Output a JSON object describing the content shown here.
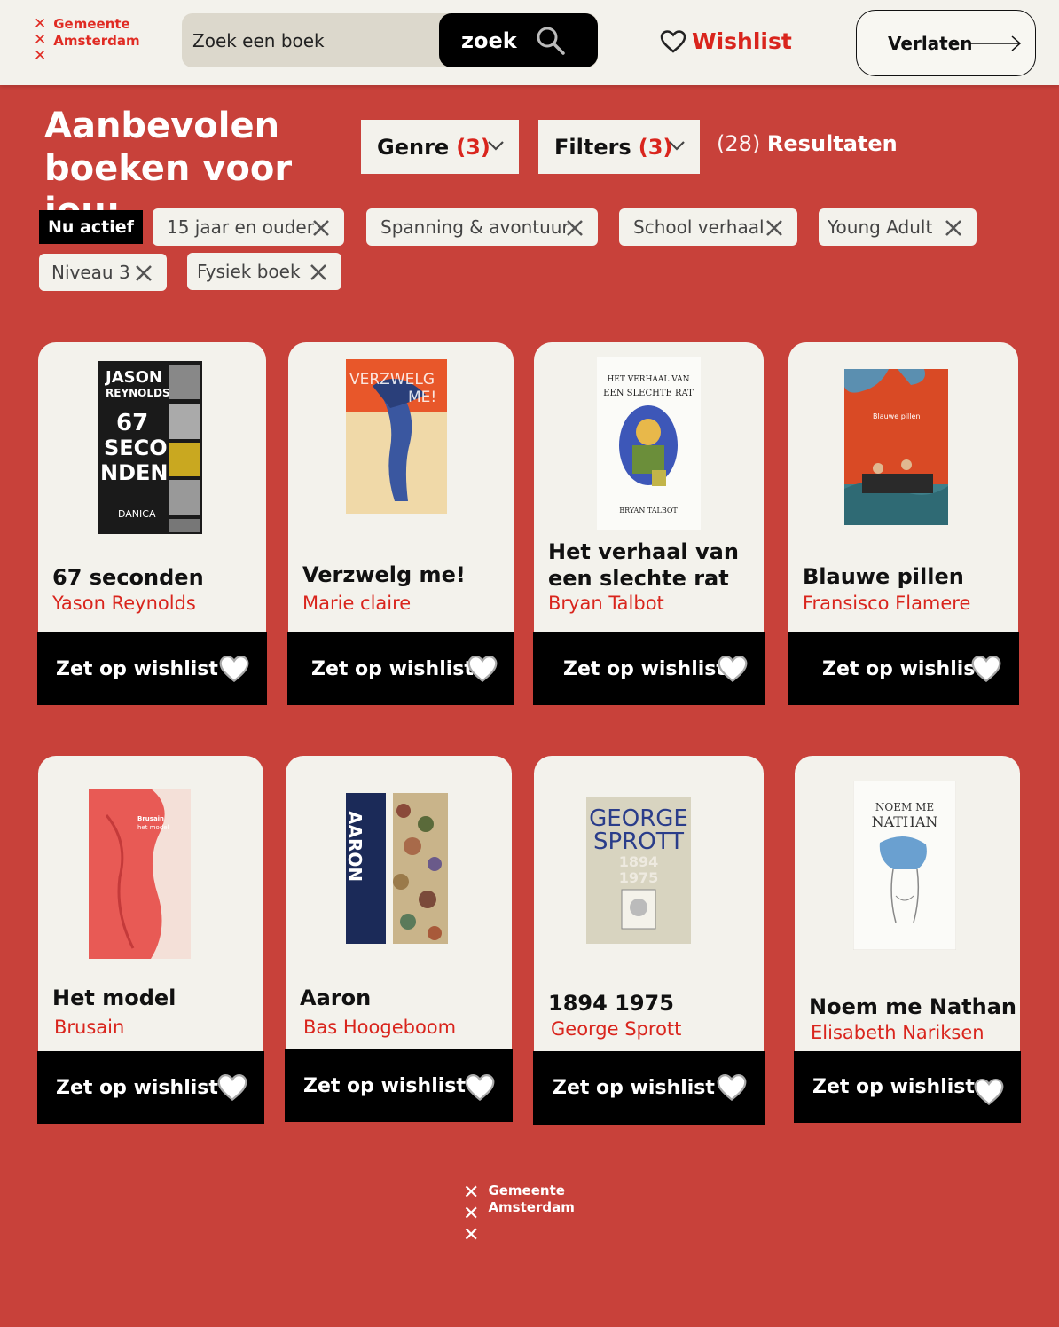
{
  "header": {
    "logo_line1": "Gemeente",
    "logo_line2": "Amsterdam",
    "search_placeholder": "Zoek een boek",
    "search_button": "zoek",
    "wishlist_label": "Wishlist",
    "leave_label": "Verlaten"
  },
  "filters": {
    "title_line1": "Aanbevolen",
    "title_line2": "boeken voor jou:",
    "genre_label": "Genre",
    "genre_count": "(3)",
    "filters_label": "Filters",
    "filters_count": "(3)",
    "results_count": "(28)",
    "results_label": "Resultaten",
    "active_label": "Nu actief",
    "chips": [
      "15 jaar en ouder",
      "Spanning & avontuur",
      "School verhaal",
      "Young Adult",
      "Niveau 3",
      "Fysiek boek"
    ]
  },
  "books": [
    {
      "title": "67 seconden",
      "author": "Yason Reynolds",
      "button": "Zet op wishlist"
    },
    {
      "title": "Verzwelg me!",
      "author": "Marie claire",
      "button": "Zet op wishlist"
    },
    {
      "title_line1": "Het verhaal van",
      "title_line2": "een slechte rat",
      "author": "Bryan Talbot",
      "button": "Zet op wishlist"
    },
    {
      "title": "Blauwe pillen",
      "author": "Fransisco Flamere",
      "button": "Zet op wishlist"
    },
    {
      "title": "Het model",
      "author": "Brusain",
      "button": "Zet op wishlist"
    },
    {
      "title": "Aaron",
      "author": "Bas Hoogeboom",
      "button": "Zet op wishlist"
    },
    {
      "title": "1894 1975",
      "author": "George Sprott",
      "button": "Zet op wishlist"
    },
    {
      "title": "Noem me Nathan",
      "author": "Elisabeth Nariksen",
      "button": "Zet op wishlist"
    }
  ],
  "covers": {
    "c1_a": "JASON",
    "c1_b": "REYNOLDS",
    "c1_c": "67",
    "c1_d": "SECO",
    "c1_e": "NDEN",
    "c1_f": "DANICA",
    "c2_a": "VERZWELG",
    "c2_b": "ME!",
    "c3_a": "HET VERHAAL VAN",
    "c3_b": "EEN SLECHTE RAT",
    "c3_c": "BRYAN TALBOT",
    "c4_a": "Blauwe pillen",
    "c5_a": "Brusain",
    "c5_b": "het model",
    "c6_a": "AARON",
    "c7_a": "GEORGE",
    "c7_b": "SPROTT",
    "c7_c": "1894",
    "c7_d": "1975",
    "c8_a": "NOEM ME",
    "c8_b": "NATHAN"
  },
  "footer": {
    "logo_line1": "Gemeente",
    "logo_line2": "Amsterdam"
  },
  "colors": {
    "background": "#c8413a",
    "accent_red": "#d9251d",
    "card": "#f3f2ec",
    "black": "#000000"
  }
}
